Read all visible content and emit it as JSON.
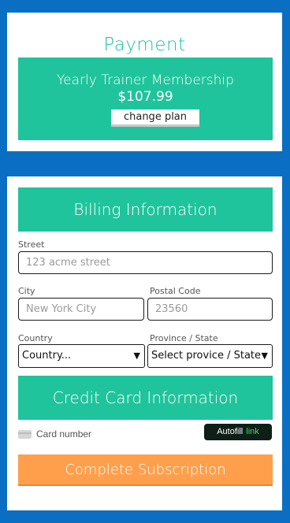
{
  "payment": {
    "title": "Payment",
    "plan_name": "Yearly Trainer Membership",
    "plan_price": "$107.99",
    "change_plan_label": "change plan"
  },
  "billing": {
    "title": "Billing Information",
    "street_label": "Street",
    "street_placeholder": "123 acme street",
    "city_label": "City",
    "city_placeholder": "New York City",
    "postal_label": "Postal Code",
    "postal_placeholder": "23560",
    "country_label": "Country",
    "country_value": "Country...",
    "province_label": "Province / State",
    "province_value": "Select provice / State"
  },
  "credit_card": {
    "title": "Credit Card Information",
    "card_number_label": "Card number",
    "autofill_label": "Autofill",
    "autofill_link": "link",
    "card_icon": "credit-card-icon"
  },
  "complete_label": "Complete Subscription",
  "colors": {
    "background": "#0a6fc2",
    "accent": "#1fc49c",
    "button_orange": "#ff9f4c",
    "link_green": "#3ddc6a"
  }
}
